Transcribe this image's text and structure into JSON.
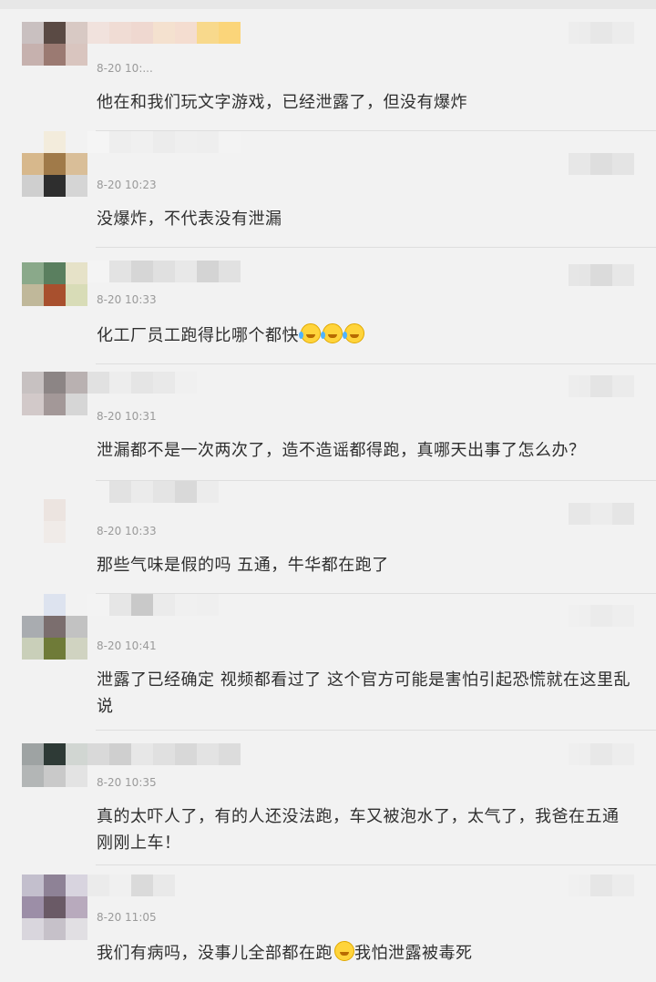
{
  "comments": [
    {
      "time": "8-20 10:...",
      "text": "他在和我们玩文字游戏，已经泄露了，但没有爆炸",
      "emojis": []
    },
    {
      "time": "8-20 10:23",
      "text": "没爆炸，不代表没有泄漏",
      "emojis": []
    },
    {
      "time": "8-20 10:33",
      "text": "化工厂员工跑得比哪个都快",
      "emojis": [
        "laugh-cry-emoji",
        "laugh-cry-emoji",
        "laugh-cry-emoji"
      ]
    },
    {
      "time": "8-20 10:31",
      "text": "泄漏都不是一次两次了，造不造谣都得跑，真哪天出事了怎么办？",
      "emojis": []
    },
    {
      "time": "8-20 10:33",
      "text": "那些气味是假的吗 五通，牛华都在跑了",
      "emojis": []
    },
    {
      "time": "8-20 10:41",
      "text": "泄露了已经确定 视频都看过了 这个官方可能是害怕引起恐慌就在这里乱说",
      "emojis": []
    },
    {
      "time": "8-20 10:35",
      "text": "真的太吓人了，有的人还没法跑，车又被泡水了，太气了，我爸在五通刚刚上车！",
      "emojis": []
    },
    {
      "time": "8-20 11:05",
      "text_before": "我们有病吗，没事儿全部都在跑",
      "text_after": "我怕泄露被毒死",
      "emojis": [
        "smile-emoji"
      ]
    }
  ],
  "colors": {
    "background": "#f2f2f2",
    "text": "#2f2f2f",
    "timestamp": "#9a9a9a",
    "divider": "#dedede"
  }
}
